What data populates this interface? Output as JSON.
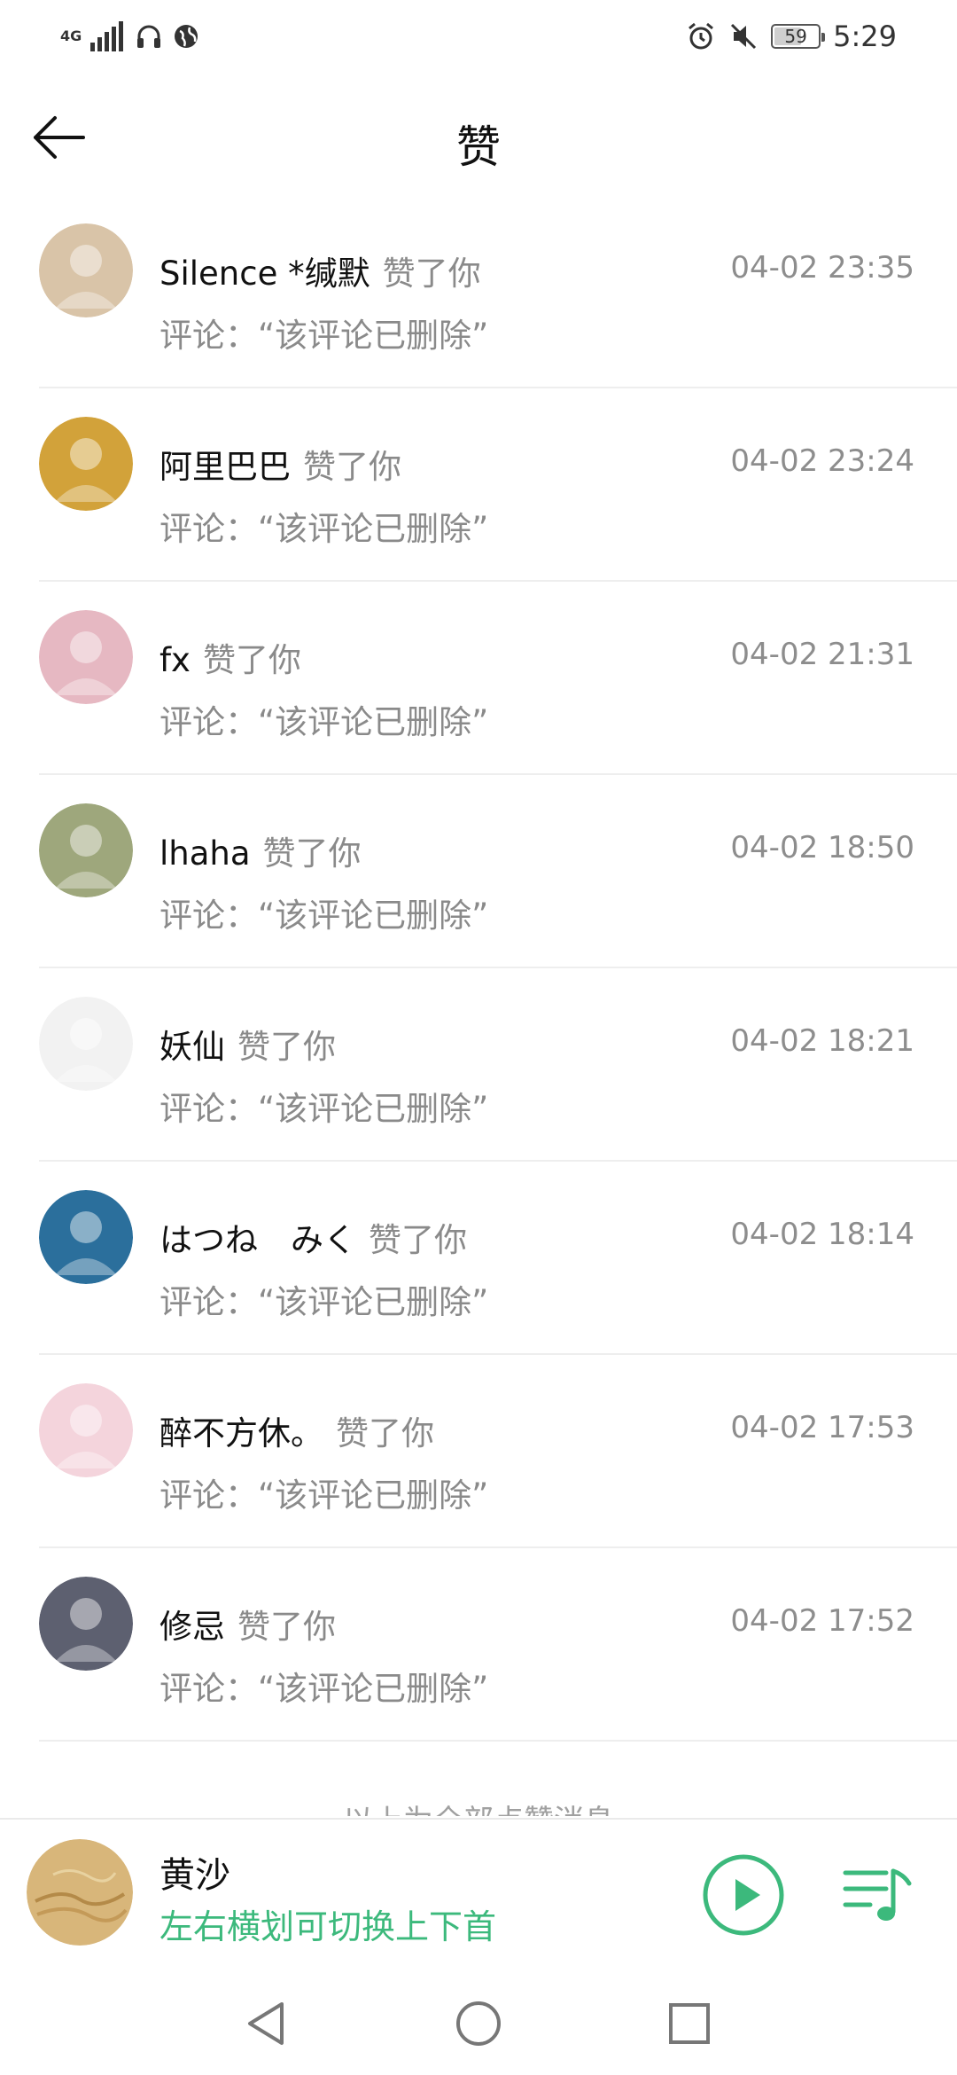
{
  "status_bar": {
    "network_label": "4G",
    "time": "5:29",
    "battery_level": "59",
    "battery_fraction": 0.59,
    "left_icons": [
      "signal-icon",
      "headphones-icon",
      "globe-icon"
    ],
    "right_icons": [
      "alarm-icon",
      "mute-icon",
      "battery-icon"
    ]
  },
  "header": {
    "title": "赞",
    "back_icon": "arrow-left-icon"
  },
  "likes": [
    {
      "name": "Silence *缄默",
      "action": "赞了你",
      "time": "04-02 23:35",
      "comment": "评论：“该评论已删除”",
      "avatar_color": "#d9c4a8"
    },
    {
      "name": "阿里巴巴",
      "action": "赞了你",
      "time": "04-02 23:24",
      "comment": "评论：“该评论已删除”",
      "avatar_color": "#d2a23a"
    },
    {
      "name": "fx",
      "action": "赞了你",
      "time": "04-02 21:31",
      "comment": "评论：“该评论已删除”",
      "avatar_color": "#e6b8c2"
    },
    {
      "name": "lhaha",
      "action": "赞了你",
      "time": "04-02 18:50",
      "comment": "评论：“该评论已删除”",
      "avatar_color": "#9ea77c"
    },
    {
      "name": "妖仙",
      "action": "赞了你",
      "time": "04-02 18:21",
      "comment": "评论：“该评论已删除”",
      "avatar_color": "#f2f2f2"
    },
    {
      "name": "はつね　みく",
      "action": "赞了你",
      "time": "04-02 18:14",
      "comment": "评论：“该评论已删除”",
      "avatar_color": "#2b6f9c"
    },
    {
      "name": "醉不方休。",
      "action": "赞了你",
      "time": "04-02 17:53",
      "comment": "评论：“该评论已删除”",
      "avatar_color": "#f4d4dc"
    },
    {
      "name": "修忌",
      "action": "赞了你",
      "time": "04-02 17:52",
      "comment": "评论：“该评论已删除”",
      "avatar_color": "#5d6070"
    }
  ],
  "end_text": "以上为全部点赞消息",
  "player": {
    "song_title": "黄沙",
    "hint": "左右横划可切换上下首",
    "accent_color": "#3cb97c",
    "cover_color": "#d8b67a",
    "play_icon": "play-circle-icon",
    "playlist_icon": "playlist-icon"
  },
  "nav": {
    "back_icon": "nav-back-icon",
    "home_icon": "nav-home-icon",
    "recents_icon": "nav-recents-icon"
  }
}
